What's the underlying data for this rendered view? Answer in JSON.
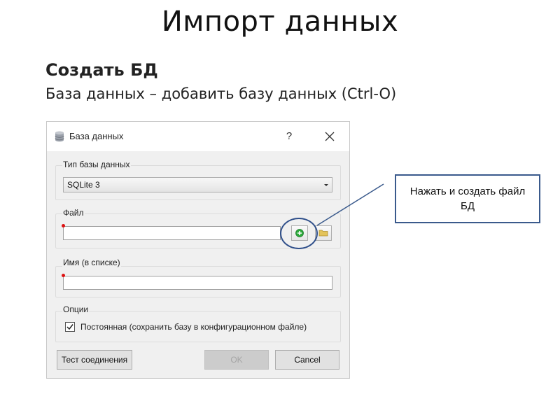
{
  "slide": {
    "title": "Импорт данных",
    "subtitle": "Создать БД",
    "menu_path": "База данных – добавить базу данных (Ctrl-O)"
  },
  "dialog": {
    "title": "База данных",
    "help_label": "?",
    "db_type": {
      "label": "Тип базы данных",
      "selected": "SQLite 3"
    },
    "file": {
      "label": "Файл",
      "value": ""
    },
    "name": {
      "label": "Имя (в списке)",
      "value": ""
    },
    "options": {
      "label": "Опции",
      "persistent_checked": true,
      "persistent_label": "Постоянная (сохранить базу в конфигурационном файле)"
    },
    "buttons": {
      "test": "Тест соединения",
      "ok": "OK",
      "cancel": "Cancel"
    }
  },
  "callout": {
    "text": "Нажать и создать файл БД"
  },
  "colors": {
    "accent_border": "#3a5a8c",
    "add_icon_green": "#2eaa3c",
    "required_marker": "#d11111"
  },
  "icons": {
    "title_icon": "database-icon",
    "create_file": "plus-circle-icon",
    "browse_file": "folder-icon",
    "close": "close-icon"
  }
}
